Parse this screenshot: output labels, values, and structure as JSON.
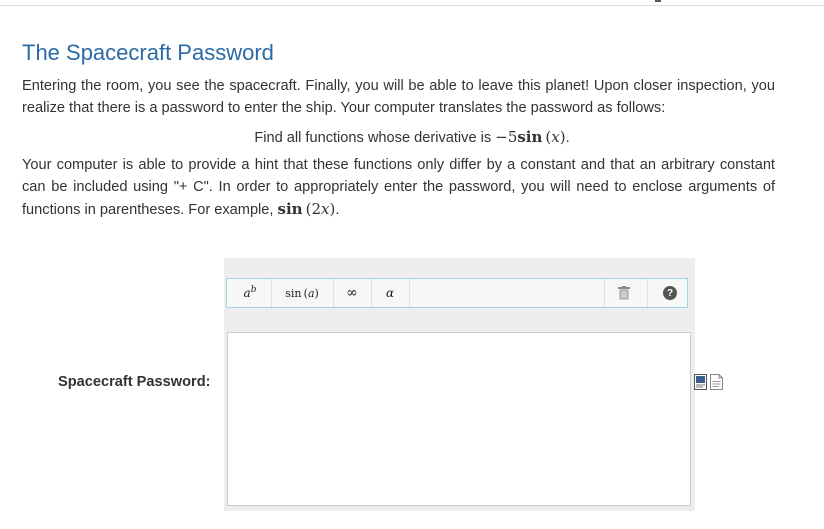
{
  "title": "The Spacecraft Password",
  "intro": "Entering the room, you see the spacecraft. Finally, you will be able to leave this planet! Upon closer inspection, you realize that there is a password to enter the ship. Your computer translates the password as follows:",
  "task": {
    "prefix": "Find all functions whose derivative is ",
    "neg": "−",
    "coef": "5",
    "fn": "sin",
    "open": " (",
    "var": "x",
    "close": ")",
    "period": "."
  },
  "hint": {
    "text": "Your computer is able to provide a hint that these functions only differ by a constant and that an arbitrary constant can be included using \"+ C\". In order to appropriately enter the password, you will need to enclose arguments of functions in parentheses. For example, ",
    "fn": "sin",
    "open": " (2",
    "var": "x",
    "close": ")",
    "period": "."
  },
  "answer_label": "Spacecraft Password:",
  "toolbar": {
    "power_base": "a",
    "power_exp": "b",
    "sin_label": "sin (",
    "sin_arg": "a",
    "sin_close": ")",
    "infinity": "∞",
    "alpha": "α",
    "help": "?"
  },
  "answer": {
    "value": ""
  },
  "icons": [
    "trash-icon",
    "help-icon",
    "preview-icon",
    "document-icon"
  ],
  "colors": {
    "title": "#2a6aa6",
    "toolbar_border": "#9fd3e6",
    "editor_bg": "#eeeeee"
  }
}
